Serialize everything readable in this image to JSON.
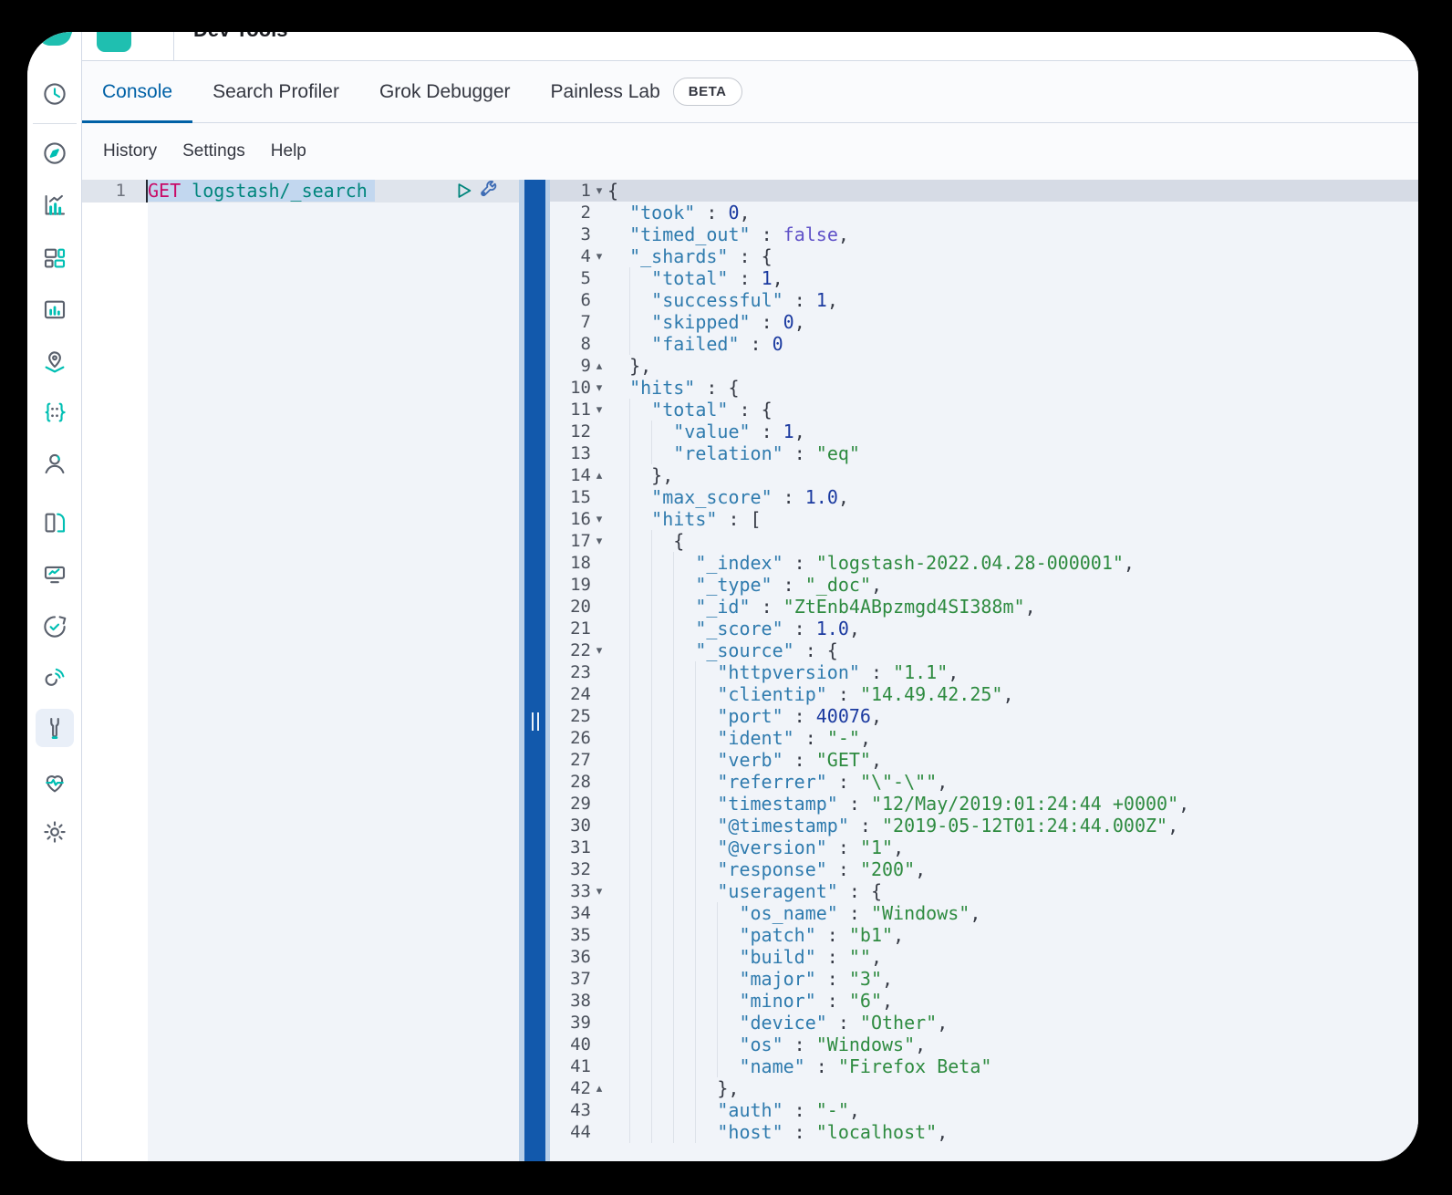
{
  "app": {
    "title": "Dev Tools"
  },
  "tabs": [
    {
      "label": "Console",
      "active": true
    },
    {
      "label": "Search Profiler"
    },
    {
      "label": "Grok Debugger"
    },
    {
      "label": "Painless Lab",
      "badge": "BETA"
    }
  ],
  "menu": {
    "items": [
      "History",
      "Settings",
      "Help"
    ]
  },
  "sidebar": {
    "items": [
      {
        "id": "recently-viewed",
        "icon": "clock-icon"
      },
      {
        "id": "discover",
        "icon": "compass-icon"
      },
      {
        "id": "visualize",
        "icon": "bar-chart-icon"
      },
      {
        "id": "dashboard",
        "icon": "dashboard-icon"
      },
      {
        "id": "canvas",
        "icon": "canvas-icon"
      },
      {
        "id": "maps",
        "icon": "map-pin-icon"
      },
      {
        "id": "machine-learning",
        "icon": "ml-dots-icon"
      },
      {
        "id": "enterprise-search",
        "icon": "user-icon"
      },
      {
        "id": "logs",
        "icon": "logs-icon"
      },
      {
        "id": "metrics",
        "icon": "metrics-icon"
      },
      {
        "id": "uptime",
        "icon": "uptime-clock-icon"
      },
      {
        "id": "apm",
        "icon": "signal-icon"
      },
      {
        "id": "dev-tools",
        "icon": "wrench-icon",
        "active": true
      },
      {
        "id": "stack-monitoring",
        "icon": "heartbeat-icon"
      },
      {
        "id": "stack-management",
        "icon": "gear-icon"
      }
    ]
  },
  "request_editor": {
    "line_number": "1",
    "method": "GET",
    "url": "logstash/_search",
    "actions": [
      {
        "id": "send-request",
        "icon": "play-icon"
      },
      {
        "id": "request-options",
        "icon": "wrench-icon"
      }
    ]
  },
  "splitter": {
    "handle_icon": "grip-lines-icon"
  },
  "output_editor": {
    "lines": [
      {
        "n": "1",
        "fold": "open",
        "indent": 0,
        "active": true,
        "tokens": [
          [
            "p",
            "{"
          ]
        ]
      },
      {
        "n": "2",
        "indent": 1,
        "tokens": [
          [
            "k",
            "\"took\""
          ],
          [
            "p",
            " : "
          ],
          [
            "n",
            "0"
          ],
          [
            "p",
            ","
          ]
        ]
      },
      {
        "n": "3",
        "indent": 1,
        "tokens": [
          [
            "k",
            "\"timed_out\""
          ],
          [
            "p",
            " : "
          ],
          [
            "b",
            "false"
          ],
          [
            "p",
            ","
          ]
        ]
      },
      {
        "n": "4",
        "fold": "open",
        "indent": 1,
        "tokens": [
          [
            "k",
            "\"_shards\""
          ],
          [
            "p",
            " : {"
          ]
        ]
      },
      {
        "n": "5",
        "indent": 2,
        "tokens": [
          [
            "k",
            "\"total\""
          ],
          [
            "p",
            " : "
          ],
          [
            "n",
            "1"
          ],
          [
            "p",
            ","
          ]
        ]
      },
      {
        "n": "6",
        "indent": 2,
        "tokens": [
          [
            "k",
            "\"successful\""
          ],
          [
            "p",
            " : "
          ],
          [
            "n",
            "1"
          ],
          [
            "p",
            ","
          ]
        ]
      },
      {
        "n": "7",
        "indent": 2,
        "tokens": [
          [
            "k",
            "\"skipped\""
          ],
          [
            "p",
            " : "
          ],
          [
            "n",
            "0"
          ],
          [
            "p",
            ","
          ]
        ]
      },
      {
        "n": "8",
        "indent": 2,
        "tokens": [
          [
            "k",
            "\"failed\""
          ],
          [
            "p",
            " : "
          ],
          [
            "n",
            "0"
          ]
        ]
      },
      {
        "n": "9",
        "fold": "close",
        "indent": 1,
        "tokens": [
          [
            "p",
            "},"
          ]
        ]
      },
      {
        "n": "10",
        "fold": "open",
        "indent": 1,
        "tokens": [
          [
            "k",
            "\"hits\""
          ],
          [
            "p",
            " : {"
          ]
        ]
      },
      {
        "n": "11",
        "fold": "open",
        "indent": 2,
        "tokens": [
          [
            "k",
            "\"total\""
          ],
          [
            "p",
            " : {"
          ]
        ]
      },
      {
        "n": "12",
        "indent": 3,
        "tokens": [
          [
            "k",
            "\"value\""
          ],
          [
            "p",
            " : "
          ],
          [
            "n",
            "1"
          ],
          [
            "p",
            ","
          ]
        ]
      },
      {
        "n": "13",
        "indent": 3,
        "tokens": [
          [
            "k",
            "\"relation\""
          ],
          [
            "p",
            " : "
          ],
          [
            "s",
            "\"eq\""
          ]
        ]
      },
      {
        "n": "14",
        "fold": "close",
        "indent": 2,
        "tokens": [
          [
            "p",
            "},"
          ]
        ]
      },
      {
        "n": "15",
        "indent": 2,
        "tokens": [
          [
            "k",
            "\"max_score\""
          ],
          [
            "p",
            " : "
          ],
          [
            "n",
            "1.0"
          ],
          [
            "p",
            ","
          ]
        ]
      },
      {
        "n": "16",
        "fold": "open",
        "indent": 2,
        "tokens": [
          [
            "k",
            "\"hits\""
          ],
          [
            "p",
            " : ["
          ]
        ]
      },
      {
        "n": "17",
        "fold": "open",
        "indent": 3,
        "tokens": [
          [
            "p",
            "{"
          ]
        ]
      },
      {
        "n": "18",
        "indent": 4,
        "tokens": [
          [
            "k",
            "\"_index\""
          ],
          [
            "p",
            " : "
          ],
          [
            "s",
            "\"logstash-2022.04.28-000001\""
          ],
          [
            "p",
            ","
          ]
        ]
      },
      {
        "n": "19",
        "indent": 4,
        "tokens": [
          [
            "k",
            "\"_type\""
          ],
          [
            "p",
            " : "
          ],
          [
            "s",
            "\"_doc\""
          ],
          [
            "p",
            ","
          ]
        ]
      },
      {
        "n": "20",
        "indent": 4,
        "tokens": [
          [
            "k",
            "\"_id\""
          ],
          [
            "p",
            " : "
          ],
          [
            "s",
            "\"ZtEnb4ABpzmgd4SI388m\""
          ],
          [
            "p",
            ","
          ]
        ]
      },
      {
        "n": "21",
        "indent": 4,
        "tokens": [
          [
            "k",
            "\"_score\""
          ],
          [
            "p",
            " : "
          ],
          [
            "n",
            "1.0"
          ],
          [
            "p",
            ","
          ]
        ]
      },
      {
        "n": "22",
        "fold": "open",
        "indent": 4,
        "tokens": [
          [
            "k",
            "\"_source\""
          ],
          [
            "p",
            " : {"
          ]
        ]
      },
      {
        "n": "23",
        "indent": 5,
        "tokens": [
          [
            "k",
            "\"httpversion\""
          ],
          [
            "p",
            " : "
          ],
          [
            "s",
            "\"1.1\""
          ],
          [
            "p",
            ","
          ]
        ]
      },
      {
        "n": "24",
        "indent": 5,
        "tokens": [
          [
            "k",
            "\"clientip\""
          ],
          [
            "p",
            " : "
          ],
          [
            "s",
            "\"14.49.42.25\""
          ],
          [
            "p",
            ","
          ]
        ]
      },
      {
        "n": "25",
        "indent": 5,
        "tokens": [
          [
            "k",
            "\"port\""
          ],
          [
            "p",
            " : "
          ],
          [
            "n",
            "40076"
          ],
          [
            "p",
            ","
          ]
        ]
      },
      {
        "n": "26",
        "indent": 5,
        "tokens": [
          [
            "k",
            "\"ident\""
          ],
          [
            "p",
            " : "
          ],
          [
            "s",
            "\"-\""
          ],
          [
            "p",
            ","
          ]
        ]
      },
      {
        "n": "27",
        "indent": 5,
        "tokens": [
          [
            "k",
            "\"verb\""
          ],
          [
            "p",
            " : "
          ],
          [
            "s",
            "\"GET\""
          ],
          [
            "p",
            ","
          ]
        ]
      },
      {
        "n": "28",
        "indent": 5,
        "tokens": [
          [
            "k",
            "\"referrer\""
          ],
          [
            "p",
            " : "
          ],
          [
            "s",
            "\"\\\"-\\\"\""
          ],
          [
            "p",
            ","
          ]
        ]
      },
      {
        "n": "29",
        "indent": 5,
        "tokens": [
          [
            "k",
            "\"timestamp\""
          ],
          [
            "p",
            " : "
          ],
          [
            "s",
            "\"12/May/2019:01:24:44 +0000\""
          ],
          [
            "p",
            ","
          ]
        ]
      },
      {
        "n": "30",
        "indent": 5,
        "tokens": [
          [
            "k",
            "\"@timestamp\""
          ],
          [
            "p",
            " : "
          ],
          [
            "s",
            "\"2019-05-12T01:24:44.000Z\""
          ],
          [
            "p",
            ","
          ]
        ]
      },
      {
        "n": "31",
        "indent": 5,
        "tokens": [
          [
            "k",
            "\"@version\""
          ],
          [
            "p",
            " : "
          ],
          [
            "s",
            "\"1\""
          ],
          [
            "p",
            ","
          ]
        ]
      },
      {
        "n": "32",
        "indent": 5,
        "tokens": [
          [
            "k",
            "\"response\""
          ],
          [
            "p",
            " : "
          ],
          [
            "s",
            "\"200\""
          ],
          [
            "p",
            ","
          ]
        ]
      },
      {
        "n": "33",
        "fold": "open",
        "indent": 5,
        "tokens": [
          [
            "k",
            "\"useragent\""
          ],
          [
            "p",
            " : {"
          ]
        ]
      },
      {
        "n": "34",
        "indent": 6,
        "tokens": [
          [
            "k",
            "\"os_name\""
          ],
          [
            "p",
            " : "
          ],
          [
            "s",
            "\"Windows\""
          ],
          [
            "p",
            ","
          ]
        ]
      },
      {
        "n": "35",
        "indent": 6,
        "tokens": [
          [
            "k",
            "\"patch\""
          ],
          [
            "p",
            " : "
          ],
          [
            "s",
            "\"b1\""
          ],
          [
            "p",
            ","
          ]
        ]
      },
      {
        "n": "36",
        "indent": 6,
        "tokens": [
          [
            "k",
            "\"build\""
          ],
          [
            "p",
            " : "
          ],
          [
            "s",
            "\"\""
          ],
          [
            "p",
            ","
          ]
        ]
      },
      {
        "n": "37",
        "indent": 6,
        "tokens": [
          [
            "k",
            "\"major\""
          ],
          [
            "p",
            " : "
          ],
          [
            "s",
            "\"3\""
          ],
          [
            "p",
            ","
          ]
        ]
      },
      {
        "n": "38",
        "indent": 6,
        "tokens": [
          [
            "k",
            "\"minor\""
          ],
          [
            "p",
            " : "
          ],
          [
            "s",
            "\"6\""
          ],
          [
            "p",
            ","
          ]
        ]
      },
      {
        "n": "39",
        "indent": 6,
        "tokens": [
          [
            "k",
            "\"device\""
          ],
          [
            "p",
            " : "
          ],
          [
            "s",
            "\"Other\""
          ],
          [
            "p",
            ","
          ]
        ]
      },
      {
        "n": "40",
        "indent": 6,
        "tokens": [
          [
            "k",
            "\"os\""
          ],
          [
            "p",
            " : "
          ],
          [
            "s",
            "\"Windows\""
          ],
          [
            "p",
            ","
          ]
        ]
      },
      {
        "n": "41",
        "indent": 6,
        "tokens": [
          [
            "k",
            "\"name\""
          ],
          [
            "p",
            " : "
          ],
          [
            "s",
            "\"Firefox Beta\""
          ]
        ]
      },
      {
        "n": "42",
        "fold": "close",
        "indent": 5,
        "tokens": [
          [
            "p",
            "},"
          ]
        ]
      },
      {
        "n": "43",
        "indent": 5,
        "tokens": [
          [
            "k",
            "\"auth\""
          ],
          [
            "p",
            " : "
          ],
          [
            "s",
            "\"-\""
          ],
          [
            "p",
            ","
          ]
        ]
      },
      {
        "n": "44",
        "indent": 5,
        "tokens": [
          [
            "k",
            "\"host\""
          ],
          [
            "p",
            " : "
          ],
          [
            "s",
            "\"localhost\""
          ],
          [
            "p",
            ","
          ]
        ]
      }
    ]
  },
  "colors": {
    "brand_teal": "#00BFB3",
    "active_tab_blue": "#0061A6",
    "splitter_blue": "#1259AC",
    "method_pink": "#C80A68",
    "url_teal": "#00857C",
    "json_key": "#2F7BAE",
    "json_string": "#2E8B40",
    "json_number": "#1B3AA0",
    "json_boolean": "#6052C8",
    "active_line": "#D6DBE5",
    "selection": "#C2D7EF"
  }
}
